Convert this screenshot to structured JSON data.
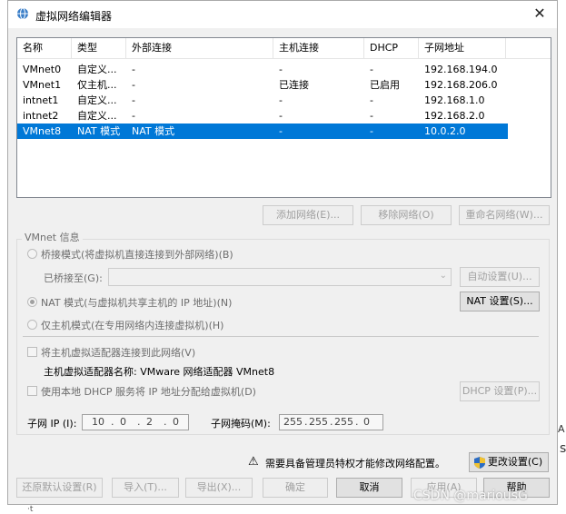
{
  "window": {
    "title": "虚拟网络编辑器",
    "close_glyph": "✕"
  },
  "table": {
    "headers": [
      "名称",
      "类型",
      "外部连接",
      "主机连接",
      "DHCP",
      "子网地址"
    ],
    "rows": [
      [
        "VMnet0",
        "自定义...",
        "-",
        "-",
        "-",
        "192.168.194.0"
      ],
      [
        "VMnet1",
        "仅主机...",
        "-",
        "已连接",
        "已启用",
        "192.168.206.0"
      ],
      [
        "intnet1",
        "自定义...",
        "-",
        "-",
        "-",
        "192.168.1.0"
      ],
      [
        "intnet2",
        "自定义...",
        "-",
        "-",
        "-",
        "192.168.2.0"
      ],
      [
        "VMnet8",
        "NAT 模式",
        "NAT 模式",
        "-",
        "-",
        "10.0.2.0"
      ]
    ],
    "selected_row": 4
  },
  "list_buttons": {
    "add": "添加网络(E)...",
    "remove": "移除网络(O)",
    "rename": "重命名网络(W)..."
  },
  "vmnet_info": {
    "legend": "VMnet 信息",
    "bridge_radio": "桥接模式(将虚拟机直接连接到外部网络)(B)",
    "bridged_to_label": "已桥接至(G):",
    "auto_settings": "自动设置(U)...",
    "nat_radio": "NAT 模式(与虚拟机共享主机的 IP 地址)(N)",
    "nat_settings": "NAT 设置(S)...",
    "hostonly_radio": "仅主机模式(在专用网络内连接虚拟机)(H)",
    "connect_adapter_check": "将主机虚拟适配器连接到此网络(V)",
    "adapter_name": "主机虚拟适配器名称: VMware 网络适配器 VMnet8",
    "dhcp_check": "使用本地 DHCP 服务将 IP 地址分配给虚拟机(D)",
    "dhcp_settings": "DHCP 设置(P)...",
    "subnet_ip_label": "子网 IP (I):",
    "subnet_ip": [
      "10",
      "0",
      "2",
      "0"
    ],
    "subnet_mask_label": "子网掩码(M):",
    "subnet_mask": [
      "255",
      "255",
      "255",
      "0"
    ]
  },
  "admin": {
    "warning_glyph": "⚠",
    "message": "需要具备管理员特权才能修改网络配置。",
    "change_settings": "更改设置(C)"
  },
  "footer": {
    "restore": "还原默认设置(R)",
    "import": "导入(T)...",
    "export": "导出(X)...",
    "ok": "确定",
    "cancel": "取消",
    "apply": "应用(A)",
    "help": "帮助"
  },
  "watermark": "CSDN @mariousG",
  "background_edge": {
    "text1": "A",
    "text2": "s",
    "text3": "·t"
  }
}
